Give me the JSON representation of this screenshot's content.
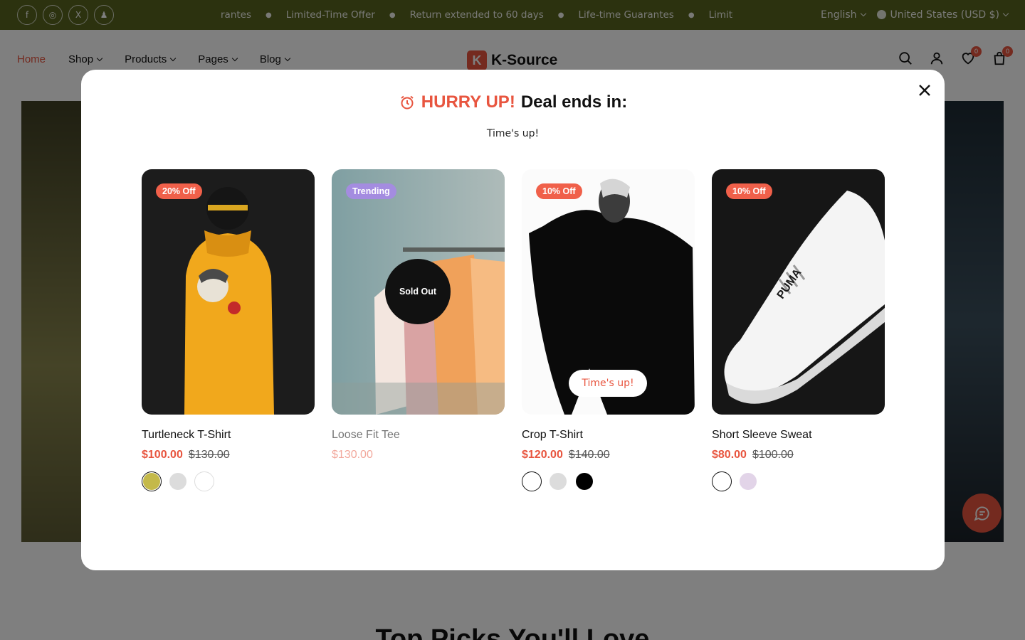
{
  "topbar": {
    "social": [
      {
        "icon": "facebook-icon",
        "glyph": "f"
      },
      {
        "icon": "instagram-icon",
        "glyph": "◎"
      },
      {
        "icon": "x-twitter-icon",
        "glyph": "X"
      },
      {
        "icon": "snapchat-icon",
        "glyph": "♟"
      }
    ],
    "ticker": [
      "rantes",
      "Limited-Time Offer",
      "Return extended to 60 days",
      "Life-time Guarantes",
      "Limite"
    ],
    "language": "English",
    "currency": "United States (USD $)"
  },
  "header": {
    "nav": [
      {
        "label": "Home",
        "active": true
      },
      {
        "label": "Shop",
        "dropdown": true
      },
      {
        "label": "Products",
        "dropdown": true
      },
      {
        "label": "Pages",
        "dropdown": true
      },
      {
        "label": "Blog",
        "dropdown": true
      }
    ],
    "logo_letter": "K",
    "logo_text": "K-Source",
    "wishlist_count": "0",
    "cart_count": "0"
  },
  "background": {
    "heading": "Top Picks You'll Love"
  },
  "modal": {
    "hurry": "HURRY UP!",
    "ends": "Deal ends in:",
    "status": "Time's up!",
    "products": [
      {
        "name": "Turtleneck T-Shirt",
        "price": "$100.00",
        "old_price": "$130.00",
        "tag": "20% Off",
        "tag_color": "#f0604a",
        "swatches": [
          "#c4b94a",
          "#dcdcdc",
          "#ffffff"
        ]
      },
      {
        "name": "Loose Fit Tee",
        "price": "$130.00",
        "old_price": "",
        "tag": "Trending",
        "tag_color": "#a48ce0",
        "sold_out": "Sold Out"
      },
      {
        "name": "Crop T-Shirt",
        "price": "$120.00",
        "old_price": "$140.00",
        "tag": "10% Off",
        "tag_color": "#f0604a",
        "timer": "Time's up!",
        "swatches": [
          "#ffffff",
          "#dcdcdc",
          "#000000"
        ]
      },
      {
        "name": "Short Sleeve Sweat",
        "price": "$80.00",
        "old_price": "$100.00",
        "tag": "10% Off",
        "tag_color": "#f0604a",
        "swatches": [
          "#ffffff",
          "#e2d4e8"
        ]
      }
    ]
  },
  "colors": {
    "accent": "#e8553f",
    "topbar": "#58651f"
  }
}
